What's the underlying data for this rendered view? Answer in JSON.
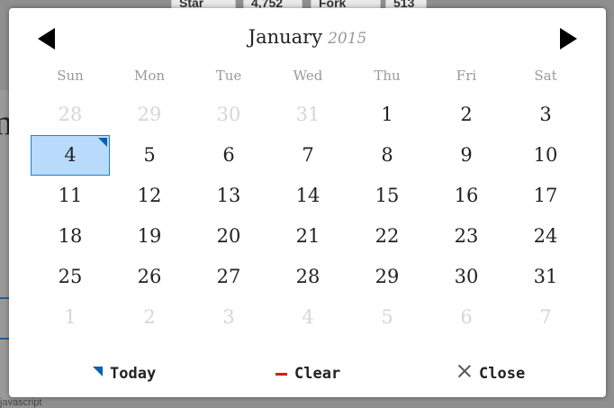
{
  "background": {
    "star_label": "Star",
    "star_count": "4,752",
    "fork_label": "Fork",
    "fork_count": "513",
    "left_letter": "n",
    "bottom_text": "javascript"
  },
  "picker": {
    "month": "January",
    "year": "2015",
    "weekdays": [
      "Sun",
      "Mon",
      "Tue",
      "Wed",
      "Thu",
      "Fri",
      "Sat"
    ],
    "weeks": [
      [
        "28",
        "29",
        "30",
        "31",
        "1",
        "2",
        "3"
      ],
      [
        "4",
        "5",
        "6",
        "7",
        "8",
        "9",
        "10"
      ],
      [
        "11",
        "12",
        "13",
        "14",
        "15",
        "16",
        "17"
      ],
      [
        "18",
        "19",
        "20",
        "21",
        "22",
        "23",
        "24"
      ],
      [
        "25",
        "26",
        "27",
        "28",
        "29",
        "30",
        "31"
      ],
      [
        "1",
        "2",
        "3",
        "4",
        "5",
        "6",
        "7"
      ]
    ],
    "selected_day": "4",
    "footer": {
      "today_label": "Today",
      "clear_label": "Clear",
      "close_label": "Close"
    },
    "colors": {
      "selected_bg": "#b8dbfb",
      "selected_border": "#1a84c8",
      "today_marker": "#0b5fb5",
      "clear_icon": "#e01a0a",
      "outside_text": "#d6d6d6",
      "weekday_text": "#9a9a9a"
    },
    "icons": {
      "prev": "triangle-left-icon",
      "next": "triangle-right-icon",
      "today": "corner-triangle-icon",
      "clear": "minus-icon",
      "close": "x-icon"
    }
  }
}
